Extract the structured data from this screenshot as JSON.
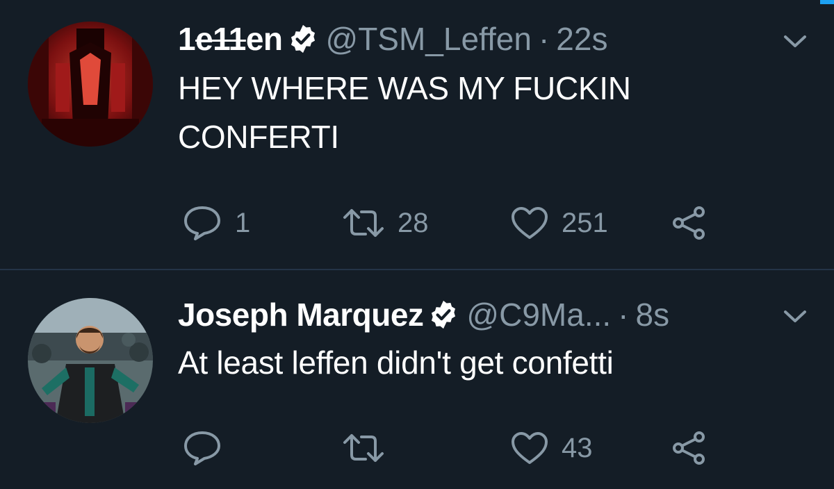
{
  "colors": {
    "background": "#141d26",
    "divider": "#243447",
    "muted": "#8899a6",
    "text": "#ffffff",
    "accent": "#1da1f2"
  },
  "tweets": [
    {
      "name_prefix": "1",
      "name_struck": "e11",
      "name_suffix": "en",
      "verified": true,
      "handle": "@TSM_Leffen",
      "separator": "·",
      "time": "22s",
      "text_line1": "HEY WHERE WAS MY FUCKIN",
      "text_line2": "CONFERTI",
      "reply_count": "1",
      "retweet_count": "28",
      "like_count": "251"
    },
    {
      "name": "Joseph Marquez",
      "verified": true,
      "handle": "@C9Ma...",
      "separator": "·",
      "time": "8s",
      "text": "At least leffen didn't get confetti",
      "reply_count": "",
      "retweet_count": "",
      "like_count": "43"
    }
  ],
  "icons": [
    "verified-icon",
    "chevron-down-icon",
    "reply-icon",
    "retweet-icon",
    "like-icon",
    "share-icon"
  ]
}
